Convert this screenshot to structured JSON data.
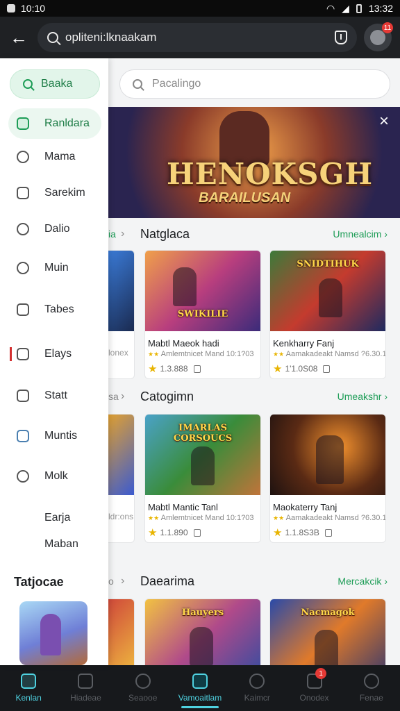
{
  "status_bar": {
    "time_left": "10:10",
    "time_right": "13:32"
  },
  "topbar": {
    "search_value": "opliteni:lknaakam",
    "notification_count": "11"
  },
  "sidebar": {
    "search_label": "Baaka",
    "items": [
      {
        "label": "Ranldara",
        "icon": "chart-icon",
        "active": true
      },
      {
        "label": "Mama",
        "icon": "refresh-icon"
      },
      {
        "label": "Sarekim",
        "icon": "lock-icon"
      },
      {
        "label": "Dalio",
        "icon": "chat-icon"
      },
      {
        "label": "Muin",
        "icon": "user-icon"
      },
      {
        "label": "Tabes",
        "icon": "cube-icon"
      },
      {
        "label": "Elays",
        "icon": "image-icon"
      },
      {
        "label": "Statt",
        "icon": "folder-icon"
      },
      {
        "label": "Muntis",
        "icon": "puzzle-icon"
      },
      {
        "label": "Molk",
        "icon": "search-icon"
      },
      {
        "label": "Earja"
      },
      {
        "label": "Maban"
      }
    ],
    "section_title": "Tatjocae"
  },
  "main": {
    "search_placeholder": "Pacalingo",
    "banner": {
      "title": "HENOKSGH",
      "subtitle": "BARAILUSAN",
      "close": "×"
    },
    "sections": [
      {
        "title": "Natglaca",
        "more": "Umnealcim",
        "peek_text": "lonex",
        "cards": [
          {
            "name": "Mabtl Maeok hadi",
            "dev": "Amlemtnicet Mand 10:1?03",
            "rating": "1.3.888",
            "art_label": "SWIKILIE"
          },
          {
            "name": "Kenkharry Fanj",
            "dev": "Aamakadeakt Namsd ?6.30.1",
            "rating": "1'1.0S08",
            "art_label": "SNIDTIHUK"
          }
        ]
      },
      {
        "title": "Catogimn",
        "more": "Umeakshr",
        "peek_text": "ldr:ons",
        "cards": [
          {
            "name": "Mabtl Mantic Tanl",
            "dev": "Amlemtnicet Mand 10:1?03",
            "rating": "1.1.890",
            "art_label": "IMARLAS CORSOUCS"
          },
          {
            "name": "Maokaterry Tanj",
            "dev": "Aamakadeakt Namsd ?6.30.1",
            "rating": "1.1.8S3B",
            "art_label": ""
          }
        ]
      },
      {
        "title": "Daearima",
        "more": "Mercakcik",
        "peek_text": "",
        "cards": [
          {
            "name": "",
            "dev": "",
            "rating": "",
            "art_label": "Hauyers"
          },
          {
            "name": "",
            "dev": "",
            "rating": "",
            "art_label": "Nacmagok"
          }
        ]
      }
    ]
  },
  "bottom_nav": [
    {
      "label": "Kenlan",
      "icon": "home-icon",
      "state": "highlight"
    },
    {
      "label": "Hiadeae",
      "icon": "book-icon"
    },
    {
      "label": "Seaooe",
      "icon": "tool-icon"
    },
    {
      "label": "Vamoaitlam",
      "icon": "store-icon",
      "state": "active"
    },
    {
      "label": "Kaimcr",
      "icon": "chat-icon"
    },
    {
      "label": "Onodex",
      "icon": "bell-icon",
      "badge": "1"
    },
    {
      "label": "Fenae",
      "icon": "search-icon"
    }
  ],
  "colors": {
    "accent_green": "#1e9d57",
    "accent_cyan": "#4fd1e0",
    "topbar_bg": "#1f2124",
    "badge_red": "#e53935"
  }
}
